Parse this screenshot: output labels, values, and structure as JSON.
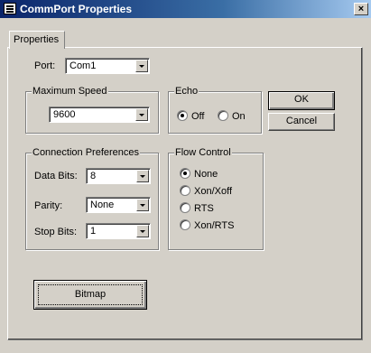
{
  "window": {
    "title": "CommPort Properties",
    "close_label": "×"
  },
  "tabs": [
    {
      "label": "Properties"
    }
  ],
  "port": {
    "label": "Port:",
    "value": "Com1"
  },
  "max_speed": {
    "title": "Maximum Speed",
    "value": "9600"
  },
  "echo": {
    "title": "Echo",
    "options": [
      {
        "label": "Off",
        "checked": true
      },
      {
        "label": "On",
        "checked": false
      }
    ]
  },
  "buttons": {
    "ok": "OK",
    "cancel": "Cancel",
    "bitmap": "Bitmap"
  },
  "connection": {
    "title": "Connection Preferences",
    "data_bits": {
      "label": "Data Bits:",
      "value": "8"
    },
    "parity": {
      "label": "Parity:",
      "value": "None"
    },
    "stop_bits": {
      "label": "Stop Bits:",
      "value": "1"
    }
  },
  "flow_control": {
    "title": "Flow Control",
    "options": [
      {
        "label": "None",
        "checked": true
      },
      {
        "label": "Xon/Xoff",
        "checked": false
      },
      {
        "label": "RTS",
        "checked": false
      },
      {
        "label": "Xon/RTS",
        "checked": false
      }
    ]
  },
  "colors": {
    "titlebar": "#0a246a",
    "face": "#d4d0c8"
  }
}
